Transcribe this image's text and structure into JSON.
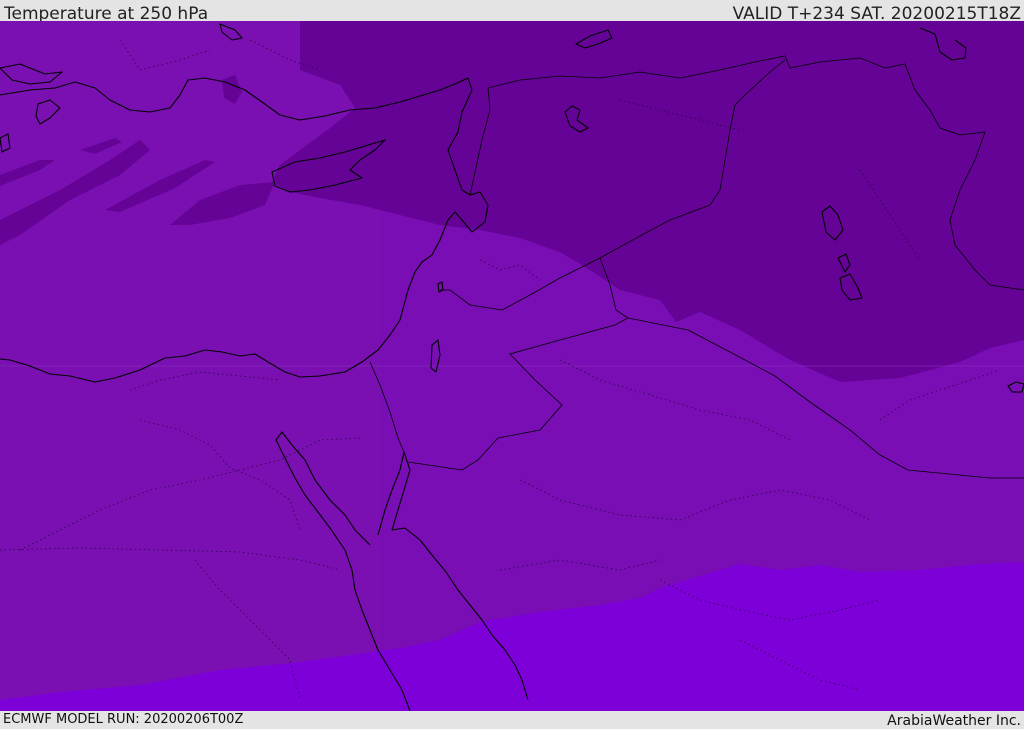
{
  "header": {
    "title": "Temperature at 250 hPa",
    "valid": "VALID T+234 SAT. 20200215T18Z"
  },
  "footer": {
    "model_run": "ECMWF MODEL RUN: 20200206T00Z",
    "credit": "ArabiaWeather Inc."
  },
  "map": {
    "field": "temperature",
    "level": "250 hPa",
    "colors": {
      "coldest": "#650397",
      "cold": "#7a10b1",
      "mid": "#780eb4",
      "warm": "#7e00d9",
      "coastline": "#000000"
    }
  }
}
